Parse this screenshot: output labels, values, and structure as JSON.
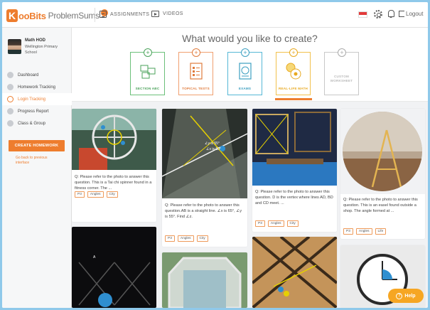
{
  "app": {
    "logo_letter": "K",
    "logo_text": "ooBits",
    "logo_sub": "ProblemSums"
  },
  "topnav": {
    "assignments": "ASSIGNMENTS",
    "videos": "VIDEOS",
    "logout": "Logout"
  },
  "user": {
    "name": "Math HOD",
    "school": "Wellington Primary School"
  },
  "sidebar": {
    "items": [
      {
        "label": "Dashboard"
      },
      {
        "label": "Homework Tracking"
      },
      {
        "label": "Login Tracking"
      },
      {
        "label": "Progress Report"
      },
      {
        "label": "Class & Group"
      }
    ],
    "create_button": "CREATE HOMEWORK",
    "go_back": "Go back to previous interface"
  },
  "create": {
    "title": "What would you like to create?",
    "types": [
      {
        "label": "SECTION ABC"
      },
      {
        "label": "TOPICAL TESTS"
      },
      {
        "label": "EXAMS"
      },
      {
        "label": "REAL-LIFE MATH"
      },
      {
        "label": "CUSTOM WORKSHEET"
      }
    ]
  },
  "questions": [
    {
      "text": "Q: Please refer to the photo to answer this question. This is a Tai chi spinner found in a fitness corner. The ...",
      "tags": [
        "P3",
        "Angles",
        "City"
      ]
    },
    {
      "text": "Q: Please refer to the photo to answer this question.AB is a straight line. ∠x is 65°, ∠y is 55°. Find ∠z.",
      "tags": [
        "P3",
        "Angles",
        "City"
      ]
    },
    {
      "text": "Q: Please refer to the photo to answer this question.   D is the vertex where lines AD, BD and CD meet. ...",
      "tags": [
        "P3",
        "Angles",
        "City"
      ]
    },
    {
      "text": "Q: Please refer to the photo to answer this question. This is an easel found outside a shop. The angle formed at ...",
      "tags": [
        "P3",
        "Angles",
        "Life"
      ]
    }
  ],
  "photo_labels": {
    "y_label": "∠y is 55°",
    "x_label": "∠x is 60°",
    "point_a": "A"
  },
  "help": "Help",
  "colors": {
    "accent": "#ee7d2e",
    "help": "#f6a623",
    "frame": "#8fc9ea"
  },
  "icons": [
    "settings-icon",
    "bell-icon",
    "logout-icon",
    "flag-icon",
    "assignments-icon",
    "videos-icon"
  ]
}
